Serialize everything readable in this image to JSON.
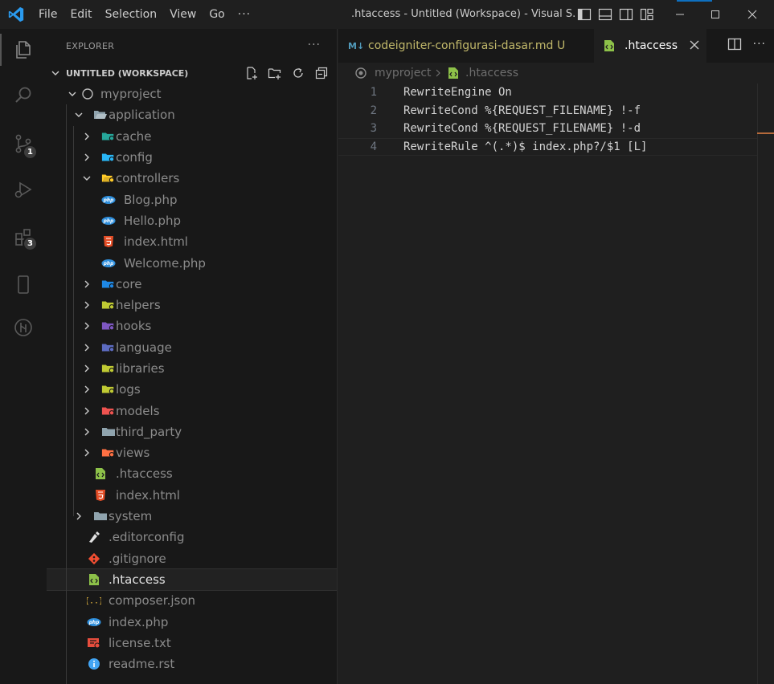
{
  "titlebar": {
    "menus": [
      "File",
      "Edit",
      "Selection",
      "View",
      "Go"
    ],
    "more": "···",
    "title": ".htaccess - Untitled (Workspace) - Visual S..."
  },
  "activity": {
    "source_control_badge": "1",
    "extensions_badge": "3"
  },
  "sidebar": {
    "header": "EXPLORER",
    "more": "···",
    "workspace": "UNTITLED (WORKSPACE)",
    "tree": [
      {
        "label": "myproject",
        "depth": 0,
        "chevron": "down",
        "icon": "root-folder-icon"
      },
      {
        "label": "application",
        "depth": 1,
        "chevron": "down",
        "icon": "folder-open-icon"
      },
      {
        "label": "cache",
        "depth": 2,
        "chevron": "right",
        "icon": "cache-folder-icon"
      },
      {
        "label": "config",
        "depth": 2,
        "chevron": "right",
        "icon": "config-folder-icon"
      },
      {
        "label": "controllers",
        "depth": 2,
        "chevron": "down",
        "icon": "controllers-folder-icon"
      },
      {
        "label": "Blog.php",
        "depth": 3,
        "chevron": "",
        "icon": "php-icon"
      },
      {
        "label": "Hello.php",
        "depth": 3,
        "chevron": "",
        "icon": "php-icon"
      },
      {
        "label": "index.html",
        "depth": 3,
        "chevron": "",
        "icon": "html-icon"
      },
      {
        "label": "Welcome.php",
        "depth": 3,
        "chevron": "",
        "icon": "php-icon"
      },
      {
        "label": "core",
        "depth": 2,
        "chevron": "right",
        "icon": "core-folder-icon"
      },
      {
        "label": "helpers",
        "depth": 2,
        "chevron": "right",
        "icon": "helpers-folder-icon"
      },
      {
        "label": "hooks",
        "depth": 2,
        "chevron": "right",
        "icon": "hooks-folder-icon"
      },
      {
        "label": "language",
        "depth": 2,
        "chevron": "right",
        "icon": "language-folder-icon"
      },
      {
        "label": "libraries",
        "depth": 2,
        "chevron": "right",
        "icon": "libraries-folder-icon"
      },
      {
        "label": "logs",
        "depth": 2,
        "chevron": "right",
        "icon": "logs-folder-icon"
      },
      {
        "label": "models",
        "depth": 2,
        "chevron": "right",
        "icon": "models-folder-icon"
      },
      {
        "label": "third_party",
        "depth": 2,
        "chevron": "right",
        "icon": "folder-icon"
      },
      {
        "label": "views",
        "depth": 2,
        "chevron": "right",
        "icon": "views-folder-icon"
      },
      {
        "label": ".htaccess",
        "depth": 2,
        "chevron": "",
        "icon": "htaccess-icon"
      },
      {
        "label": "index.html",
        "depth": 2,
        "chevron": "",
        "icon": "html-icon"
      },
      {
        "label": "system",
        "depth": 1,
        "chevron": "right",
        "icon": "folder-icon"
      },
      {
        "label": ".editorconfig",
        "depth": 1,
        "chevron": "",
        "icon": "editorconfig-icon"
      },
      {
        "label": ".gitignore",
        "depth": 1,
        "chevron": "",
        "icon": "git-icon"
      },
      {
        "label": ".htaccess",
        "depth": 1,
        "chevron": "",
        "icon": "htaccess-icon",
        "selected": true
      },
      {
        "label": "composer.json",
        "depth": 1,
        "chevron": "",
        "icon": "json-icon"
      },
      {
        "label": "index.php",
        "depth": 1,
        "chevron": "",
        "icon": "php-icon"
      },
      {
        "label": "license.txt",
        "depth": 1,
        "chevron": "",
        "icon": "license-icon"
      },
      {
        "label": "readme.rst",
        "depth": 1,
        "chevron": "",
        "icon": "info-icon"
      }
    ]
  },
  "tabs": [
    {
      "label": "codeigniter-configurasi-dasar.md",
      "status": "U",
      "icon": "markdown-icon"
    },
    {
      "label": ".htaccess",
      "icon": "htaccess-icon"
    }
  ],
  "breadcrumb": {
    "project": "myproject",
    "file": ".htaccess"
  },
  "editor": {
    "lines": [
      {
        "num": "1",
        "text": "RewriteEngine On"
      },
      {
        "num": "2",
        "text": "RewriteCond %{REQUEST_FILENAME} !-f"
      },
      {
        "num": "3",
        "text": "RewriteCond %{REQUEST_FILENAME} !-d"
      },
      {
        "num": "4",
        "text": "RewriteRule ^(.*)$ index.php?/$1 [L]"
      }
    ]
  },
  "colors": {
    "accent": "#0e70c0",
    "modified_tab": "#c1b86a",
    "scroll_marker": "#b4693a"
  }
}
